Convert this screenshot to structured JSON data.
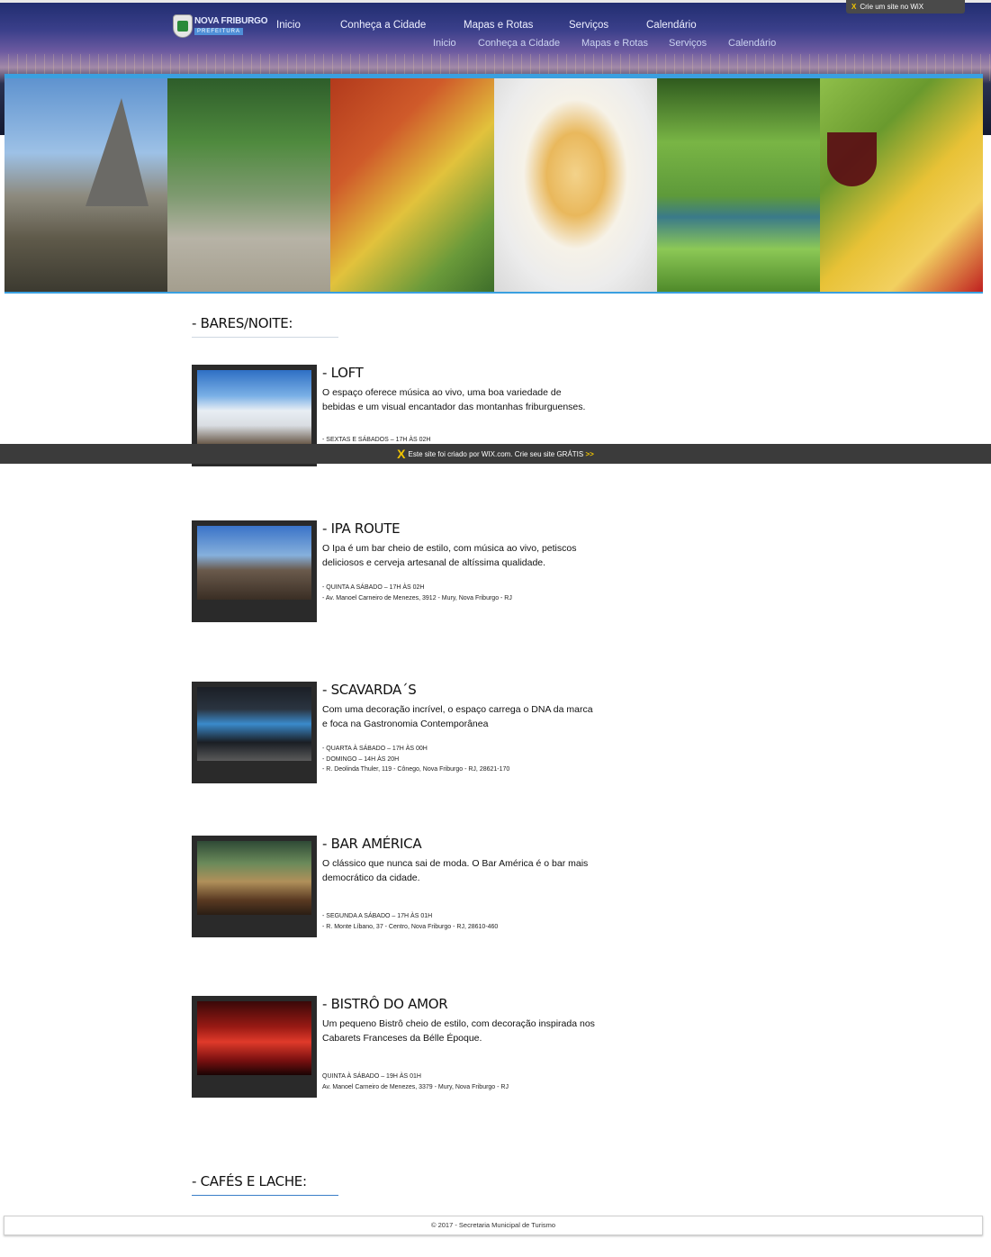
{
  "header": {
    "logo_name": "NOVA FRIBURGO",
    "logo_sub": "PREFEITURA",
    "nav_primary": [
      "Inicio",
      "Conheça a Cidade",
      "Mapas e Rotas",
      "Serviços",
      "Calendário"
    ],
    "nav_secondary": [
      "Inicio",
      "Conheça a Cidade",
      "Mapas e Rotas",
      "Serviços",
      "Calendário"
    ],
    "wix_badge": "Crie um site no WiX"
  },
  "strip": {
    "photos": [
      "mountain-photo",
      "street-photo",
      "houses-photo",
      "soup-photo",
      "garden-photo",
      "cheese-wine-photo"
    ]
  },
  "sections": {
    "bares_title": "- BARES/NOITE:",
    "cafes_title": "- CAFÉS E LACHE:"
  },
  "venues": [
    {
      "title": "- LOFT",
      "desc": "O espaço oferece música ao vivo, uma boa variedade de bebidas e um visual encantador das montanhas friburguenses.",
      "details": [
        "- SEXTAS E SÁBADOS – 17H ÀS 02H"
      ]
    },
    {
      "title": "- IPA ROUTE",
      "desc": "O Ipa é um bar cheio de estilo, com música ao vivo, petiscos deliciosos e cerveja artesanal de altíssima qualidade.",
      "details": [
        "- QUINTA A SÁBADO – 17H ÀS 02H",
        "- Av. Manoel Carneiro de Menezes, 3912 - Mury, Nova Friburgo - RJ"
      ]
    },
    {
      "title": "- SCAVARDA´S",
      "desc": "Com uma decoração incrível, o espaço carrega o DNA da marca e foca na Gastronomia Contemporânea",
      "details": [
        "- QUARTA À SÁBADO – 17H ÀS 00H",
        "- DOMINGO – 14H ÀS 20H",
        "- R. Deolinda Thuler, 119 - Cônego, Nova Friburgo - RJ, 28621-170"
      ]
    },
    {
      "title": "- BAR AMÉRICA",
      "desc": "O clássico que nunca sai de moda. O Bar América é o bar mais democrático da cidade.",
      "details": [
        "- SEGUNDA A SÁBADO – 17H ÀS 01H",
        "- R. Monte Líbano, 37 - Centro, Nova Friburgo - RJ, 28610-460"
      ]
    },
    {
      "title": "- BISTRÔ DO AMOR",
      "desc": "Um pequeno Bistrô cheio de estilo, com decoração inspirada nos Cabarets Franceses da Bélle Époque.",
      "details": [
        "QUINTA À SÁBADO – 19H ÀS 01H",
        "Av. Manoel Carneiro de Menezes, 3379 - Mury, Nova Friburgo - RJ"
      ]
    }
  ],
  "wix_banner": {
    "text": "Este site foi criado por WIX.com. Crie seu site GRÁTIS",
    "arrow": ">>"
  },
  "footer": {
    "text": "© 2017 - Secretaria Municipal de Turismo"
  }
}
